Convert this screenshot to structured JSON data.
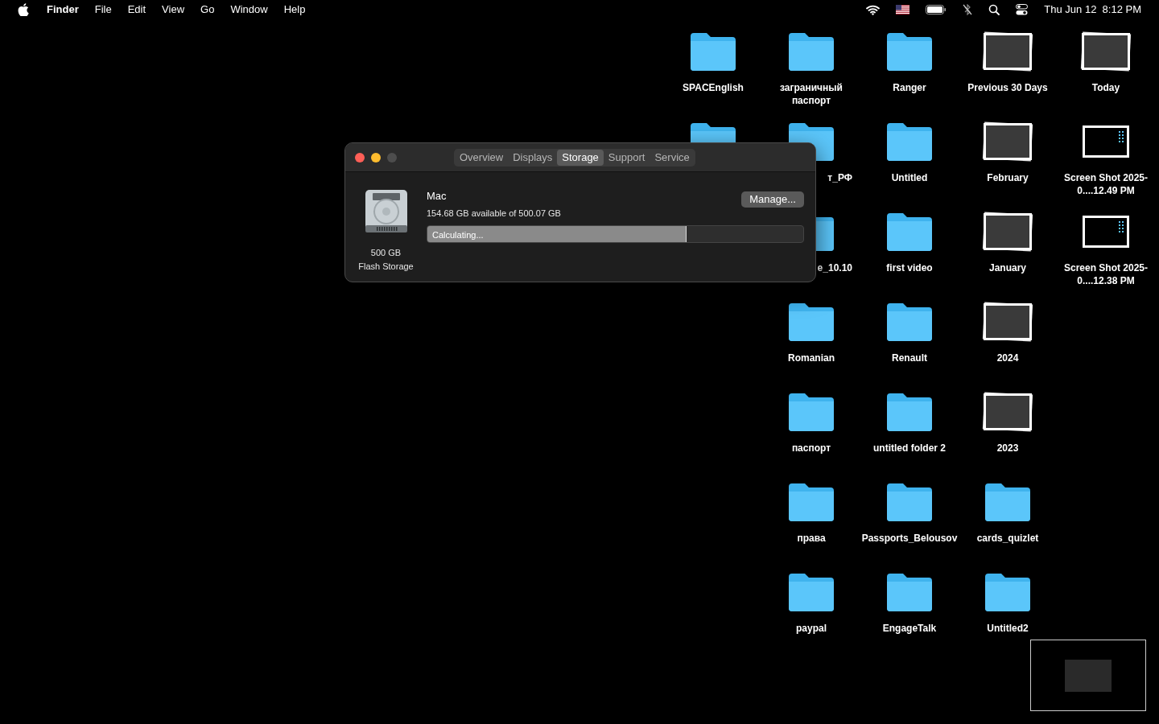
{
  "menu_bar": {
    "app": "Finder",
    "menus": [
      "File",
      "Edit",
      "View",
      "Go",
      "Window",
      "Help"
    ],
    "clock": "Thu Jun 12  8:12 PM"
  },
  "window": {
    "tabs": [
      {
        "label": "Overview",
        "selected": false
      },
      {
        "label": "Displays",
        "selected": false
      },
      {
        "label": "Storage",
        "selected": true
      },
      {
        "label": "Support",
        "selected": false
      },
      {
        "label": "Service",
        "selected": false
      }
    ],
    "disk": {
      "caption": [
        "500 GB",
        "Flash Storage"
      ],
      "name": "Mac",
      "available": "154.68 GB available of 500.07 GB",
      "bar_label": "Calculating...",
      "level": 0.69
    },
    "manage_button": "Manage..."
  },
  "desktop_rows": [
    [
      {
        "kind": "folder",
        "label": "SPACEnglish"
      },
      {
        "kind": "folder",
        "label": "заграничный паспорт"
      },
      {
        "kind": "folder",
        "label": "Ranger"
      },
      {
        "kind": "stack",
        "label": "Previous 30 Days"
      },
      {
        "kind": "stack",
        "label": "Today"
      }
    ],
    [
      {
        "kind": "folder"
      },
      {
        "kind": "folder",
        "label": "т_РФ",
        "covered": true
      },
      {
        "kind": "folder",
        "label": "Untitled"
      },
      {
        "kind": "stack",
        "label": "February"
      },
      {
        "kind": "screenshot",
        "label": "Screen Shot 2025-0....12.49 PM"
      }
    ],
    [
      null,
      {
        "kind": "folder",
        "label": "e_10.10",
        "covered": true
      },
      {
        "kind": "folder",
        "label": "first video"
      },
      {
        "kind": "stack",
        "label": "January"
      },
      {
        "kind": "screenshot",
        "label": "Screen Shot 2025-0....12.38 PM"
      }
    ],
    [
      null,
      {
        "kind": "folder",
        "label": "Romanian"
      },
      {
        "kind": "folder",
        "label": "Renault"
      },
      {
        "kind": "stack",
        "label": "2024"
      },
      null
    ],
    [
      null,
      {
        "kind": "folder",
        "label": "паспорт"
      },
      {
        "kind": "folder",
        "label": "untitled folder 2"
      },
      {
        "kind": "stack",
        "label": "2023"
      },
      null
    ],
    [
      null,
      {
        "kind": "folder",
        "label": "права"
      },
      {
        "kind": "folder",
        "label": "Passports_Belousov"
      },
      {
        "kind": "folder",
        "label": "cards_quizlet"
      },
      null
    ],
    [
      null,
      {
        "kind": "folder",
        "label": "paypal"
      },
      {
        "kind": "folder",
        "label": "EngageTalk"
      },
      {
        "kind": "folder",
        "label": "Untitled2"
      },
      null
    ]
  ]
}
